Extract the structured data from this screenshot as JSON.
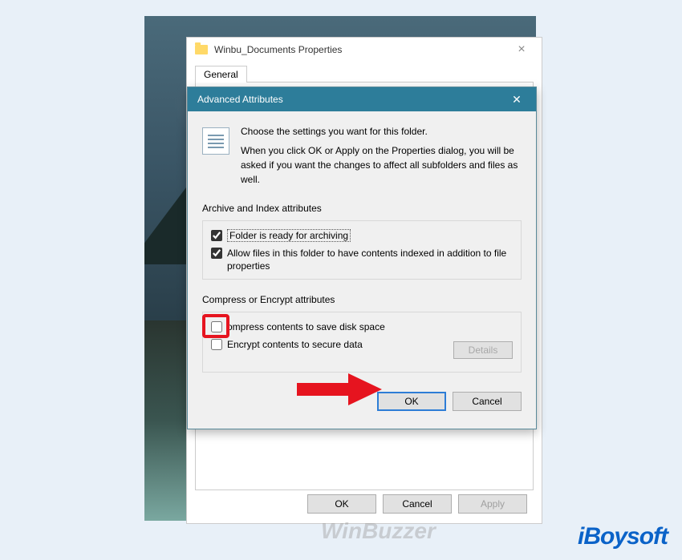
{
  "properties": {
    "title": "Winbu_Documents Properties",
    "tabs": {
      "general": "General"
    },
    "buttons": {
      "ok": "OK",
      "cancel": "Cancel",
      "apply": "Apply"
    }
  },
  "advanced": {
    "title": "Advanced Attributes",
    "intro1": "Choose the settings you want for this folder.",
    "intro2": "When you click OK or Apply on the Properties dialog, you will be asked if you want the changes to affect all subfolders and files as well.",
    "section1": {
      "label": "Archive and Index attributes",
      "archive": "Folder is ready for archiving",
      "index": "Allow files in this folder to have contents indexed in addition to file properties"
    },
    "section2": {
      "label": "Compress or Encrypt attributes",
      "compress": "ompress contents to save disk space",
      "encrypt": "Encrypt contents to secure data",
      "details": "Details"
    },
    "buttons": {
      "ok": "OK",
      "cancel": "Cancel"
    }
  },
  "watermarks": {
    "winbuzzer": "WinBuzzer",
    "iboysoft": "iBoysoft"
  }
}
